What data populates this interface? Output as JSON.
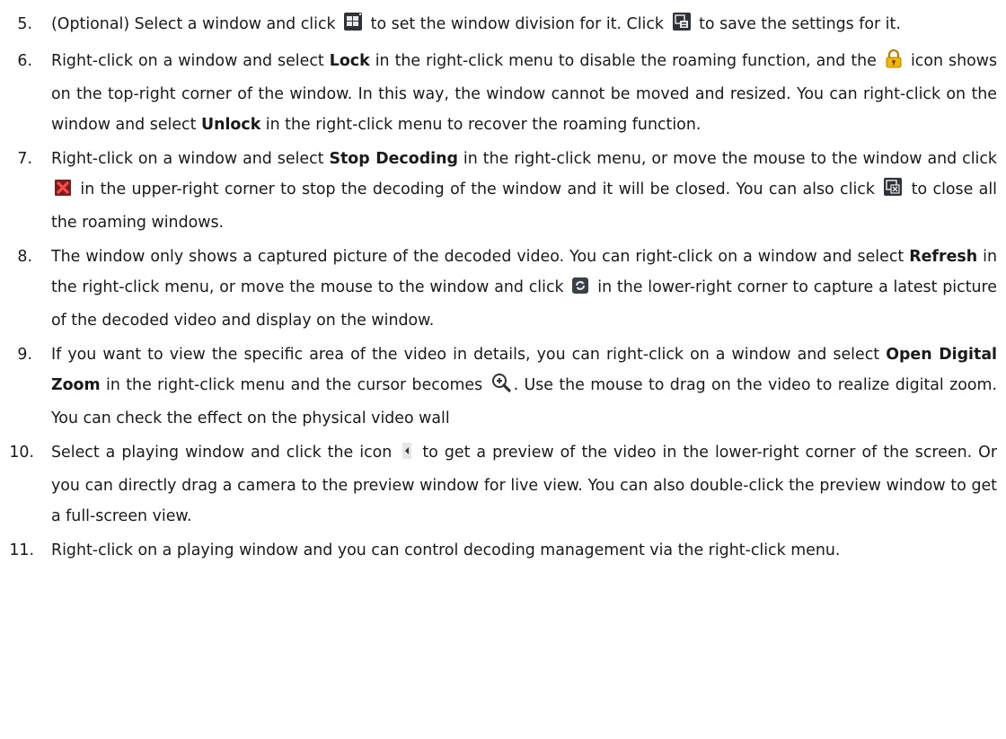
{
  "steps": [
    {
      "num": "5.",
      "s": [
        "(Optional) Select a window and click",
        "to set the window division for it. Click",
        "to save the settings for it."
      ]
    },
    {
      "num": "6.",
      "s": [
        "Right-click on a window and select",
        "Lock",
        "in the right-click menu to disable the roaming function, and the",
        "icon shows on the top-right corner of the window. In this way, the window cannot be moved and resized. You can right-click on the window and select",
        "Unlock",
        "in the right-click menu to recover the roaming function."
      ]
    },
    {
      "num": "7.",
      "s": [
        "Right-click on a window and select",
        "Stop Decoding",
        "in the right-click menu, or move the mouse to the window and click",
        "in the upper-right corner to stop the decoding of the window and it will be closed. You can also click",
        "to close all the roaming windows."
      ]
    },
    {
      "num": "8.",
      "s": [
        "The window only shows a captured picture of the decoded video. You can right-click on a window and select",
        "Refresh",
        "in the right-click menu, or move the mouse to the window and click",
        "in the lower-right corner to capture a latest picture of the decoded video and display on the window."
      ]
    },
    {
      "num": "9.",
      "s": [
        "If you want to view the specific area of the video in details, you can right-click on a window and select",
        "Open Digital Zoom",
        "in the right-click menu and the cursor becomes",
        ". Use the mouse to drag on the video to realize digital zoom. You can check the effect on the physical video wall"
      ]
    },
    {
      "num": "10.",
      "s": [
        "Select a playing window and click the icon",
        "to get a preview of the video in the lower-right corner of the screen. Or you can directly drag a camera to the preview window for live view. You can also double-click the preview window to get a full-screen view."
      ]
    },
    {
      "num": "11.",
      "s": [
        "Right-click on a playing window and you can control decoding management via the right-click menu."
      ]
    }
  ],
  "icons": {
    "window_division": "window-division-icon",
    "save_settings": "save-settings-icon",
    "lock": "lock-icon",
    "stop_decoding": "stop-decoding-icon",
    "close_all": "close-all-windows-icon",
    "refresh": "refresh-icon",
    "digital_zoom": "digital-zoom-cursor-icon",
    "preview": "preview-arrow-icon"
  },
  "colors": {
    "text": "#1a1a1a",
    "lock": "#f2b705",
    "stop": "#e03030"
  }
}
